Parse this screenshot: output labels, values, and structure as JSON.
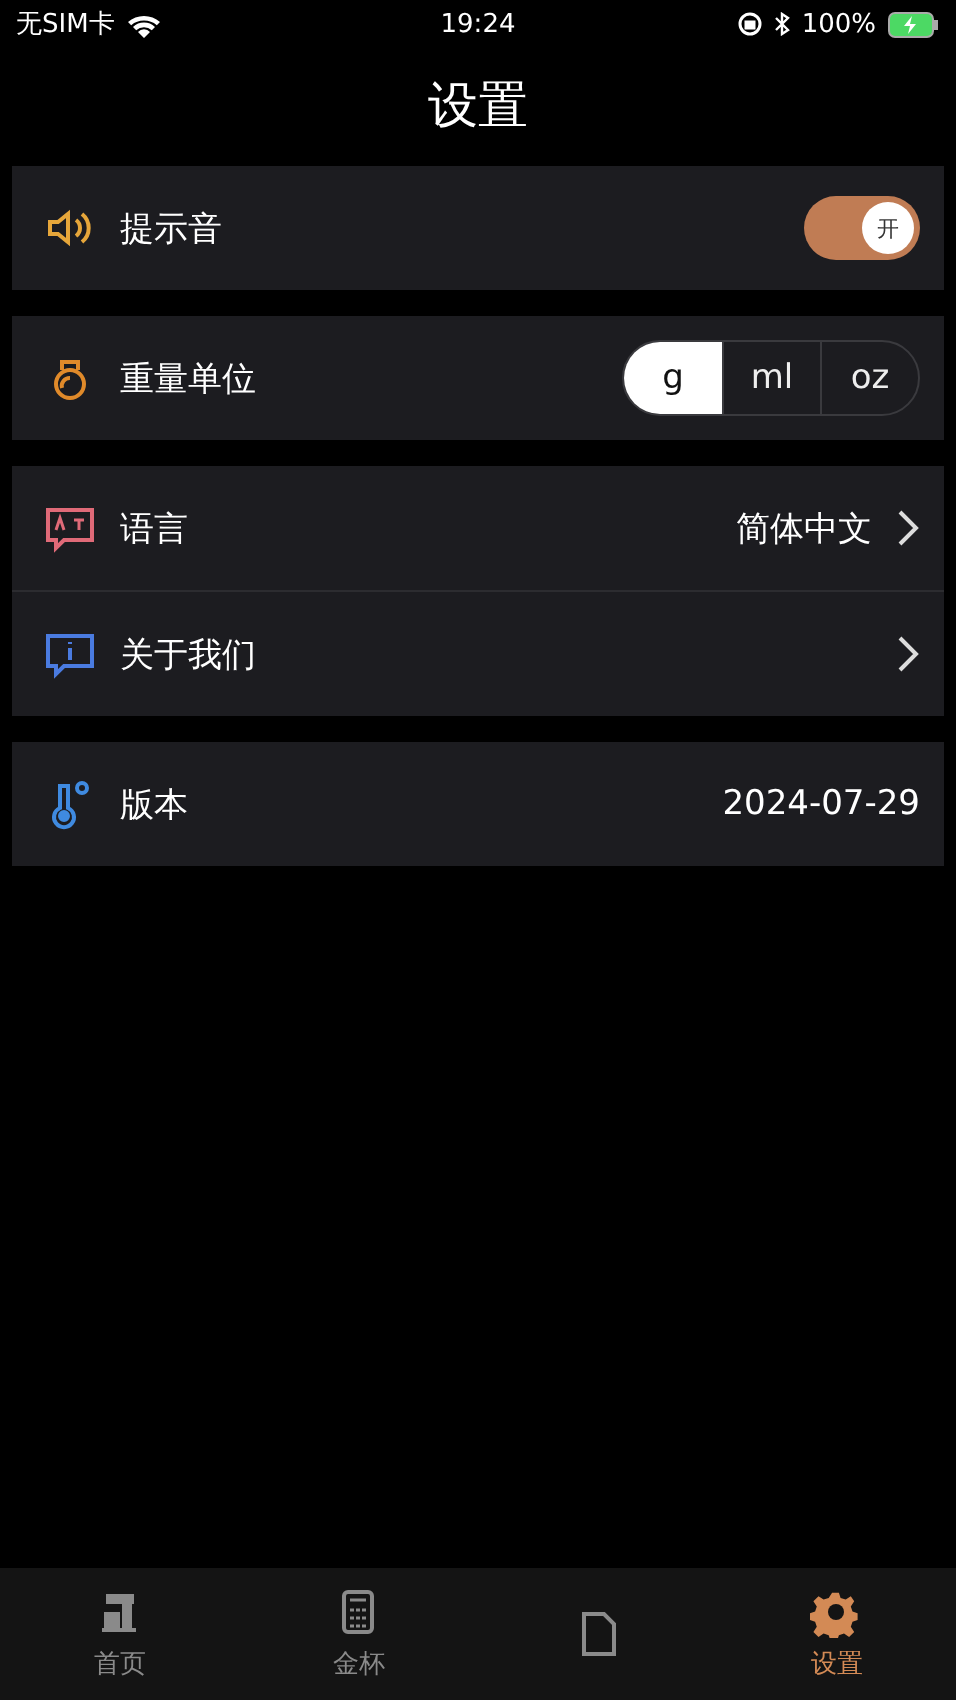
{
  "status_bar": {
    "carrier": "无SIM卡",
    "time": "19:24",
    "battery": "100%"
  },
  "title": "设置",
  "groups": [
    {
      "rows": [
        {
          "kind": "toggle",
          "label": "提示音",
          "on": true,
          "knob": "开"
        }
      ]
    },
    {
      "rows": [
        {
          "kind": "segments",
          "label": "重量单位",
          "options": [
            {
              "label": "g",
              "selected": true
            },
            {
              "label": "ml",
              "selected": false
            },
            {
              "label": "oz",
              "selected": false
            }
          ]
        }
      ]
    },
    {
      "rows": [
        {
          "kind": "link",
          "label": "语言",
          "value": "简体中文"
        },
        {
          "kind": "link",
          "label": "关于我们"
        }
      ]
    },
    {
      "rows": [
        {
          "kind": "value",
          "label": "版本",
          "value": "2024-07-29"
        }
      ]
    }
  ],
  "tabs": [
    {
      "label": "首页",
      "selected": false
    },
    {
      "label": "金杯",
      "selected": false
    },
    {
      "selected": false
    },
    {
      "label": "设置",
      "selected": true
    }
  ]
}
